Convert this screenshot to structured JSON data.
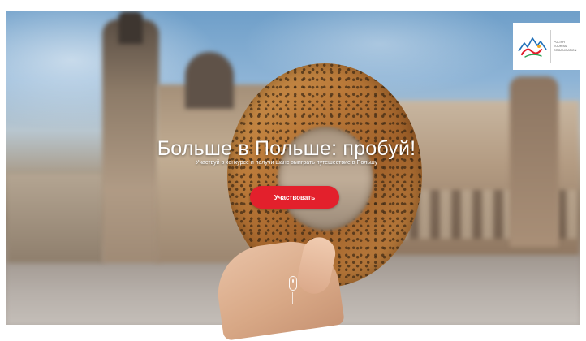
{
  "hero": {
    "headline": "Больше в Польше: пробуй!",
    "subline": "Участвуй в конкурсе и получи шанс выиграть путешествие в Польшу",
    "cta_label": "Участвовать"
  },
  "logo": {
    "lines": [
      "POLISH",
      "TOURISM",
      "ORGANISATION"
    ]
  },
  "colors": {
    "cta": "#e3202c",
    "text": "#ffffff"
  }
}
